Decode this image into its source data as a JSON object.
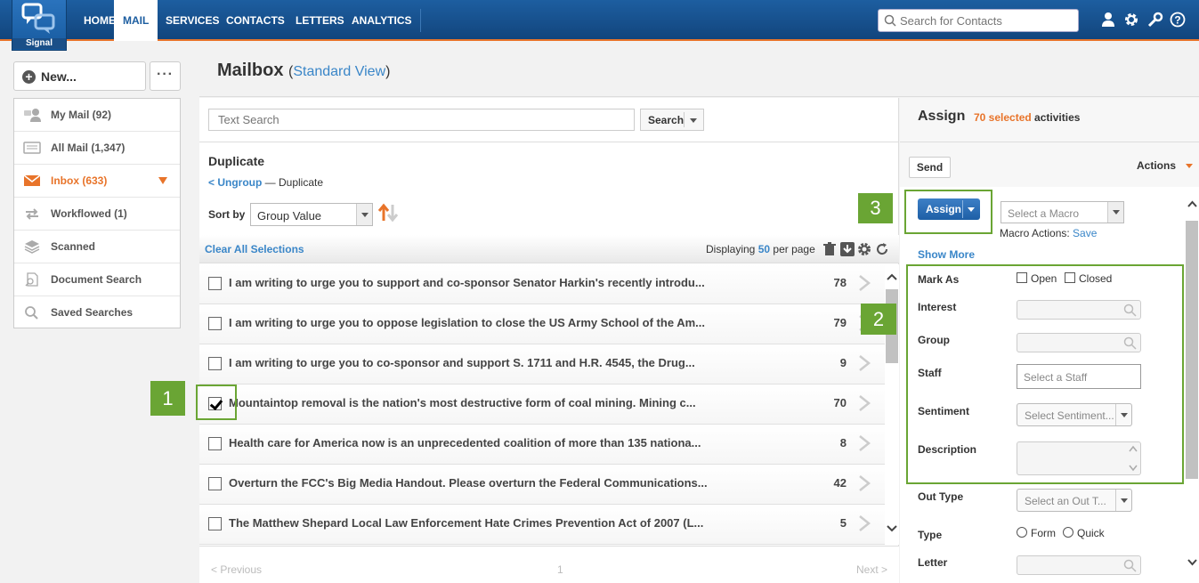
{
  "app": {
    "logo_text": "Signal"
  },
  "nav": {
    "items": [
      "HOME",
      "MAIL",
      "SERVICES",
      "CONTACTS",
      "LETTERS",
      "ANALYTICS"
    ],
    "active": "MAIL"
  },
  "header_search": {
    "placeholder": "Search for Contacts"
  },
  "left": {
    "new_label": "New...",
    "more_label": "···",
    "folders": [
      {
        "label": "My Mail (92)",
        "icon": "people-icon"
      },
      {
        "label": "All Mail (1,347)",
        "icon": "inbox-tray-icon"
      },
      {
        "label": "Inbox (633)",
        "icon": "envelope-icon",
        "active": true
      },
      {
        "label": "Workflowed (1)",
        "icon": "arrows-icon"
      },
      {
        "label": "Scanned",
        "icon": "stack-icon"
      },
      {
        "label": "Document Search",
        "icon": "doc-search-icon"
      },
      {
        "label": "Saved Searches",
        "icon": "magnifier-icon"
      }
    ]
  },
  "page": {
    "title": "Mailbox",
    "view_open": "(",
    "view_link": "Standard View",
    "view_close": ")"
  },
  "mid": {
    "text_search_placeholder": "Text Search",
    "search_label": "Search",
    "group_title": "Duplicate",
    "ungroup_link": "< Ungroup",
    "crumb_sep": " — Duplicate",
    "sort_by": "Sort by",
    "sort_value": "Group Value",
    "clear_all": "Clear All Selections",
    "displaying_pre": "Displaying ",
    "per_page": "50",
    "displaying_post": " per page",
    "rows": [
      {
        "text": "I am writing to urge you to support and co-sponsor Senator Harkin's recently introdu...",
        "count": "78",
        "checked": false
      },
      {
        "text": "I am writing to urge you to oppose legislation to close the US Army School of the Am...",
        "count": "79",
        "checked": false
      },
      {
        "text": "I am writing to urge you to co-sponsor and support S. 1711 and H.R. 4545, the Drug...",
        "count": "9",
        "checked": false
      },
      {
        "text": "Mountaintop removal is the nation's most destructive form of coal mining. Mining c...",
        "count": "70",
        "checked": true
      },
      {
        "text": "Health care for America now is an unprecedented coalition of more than 135 nationa...",
        "count": "8",
        "checked": false
      },
      {
        "text": "Overturn the FCC's Big Media Handout. Please overturn the Federal Communications...",
        "count": "42",
        "checked": false
      },
      {
        "text": "The Matthew Shepard Local Law Enforcement Hate Crimes Prevention Act of 2007 (L...",
        "count": "5",
        "checked": false
      }
    ],
    "pager": {
      "prev": "< Previous",
      "page": "1",
      "next": "Next >"
    }
  },
  "right": {
    "title": "Assign",
    "selected": "70 selected",
    "activities": " activities",
    "send": "Send",
    "actions": "Actions",
    "assign_btn": "Assign",
    "macro_placeholder": "Select a Macro",
    "macro_actions": "Macro Actions: ",
    "macro_save": "Save",
    "show_more": "Show More",
    "fields": {
      "mark_as": "Mark As",
      "open": "Open",
      "closed": "Closed",
      "interest": "Interest",
      "group": "Group",
      "staff": "Staff",
      "staff_placeholder": "Select a Staff",
      "sentiment": "Sentiment",
      "sentiment_placeholder": "Select Sentiment...",
      "description": "Description",
      "out_type": "Out Type",
      "out_type_placeholder": "Select an Out T...",
      "type": "Type",
      "form": "Form",
      "quick": "Quick",
      "letter": "Letter"
    }
  },
  "callouts": {
    "one": "1",
    "two": "2",
    "three": "3"
  },
  "colors": {
    "brand_blue": "#1d5ea0",
    "accent_orange": "#e8742a",
    "callout_green": "#6aa534",
    "link_blue": "#3a86c8"
  }
}
